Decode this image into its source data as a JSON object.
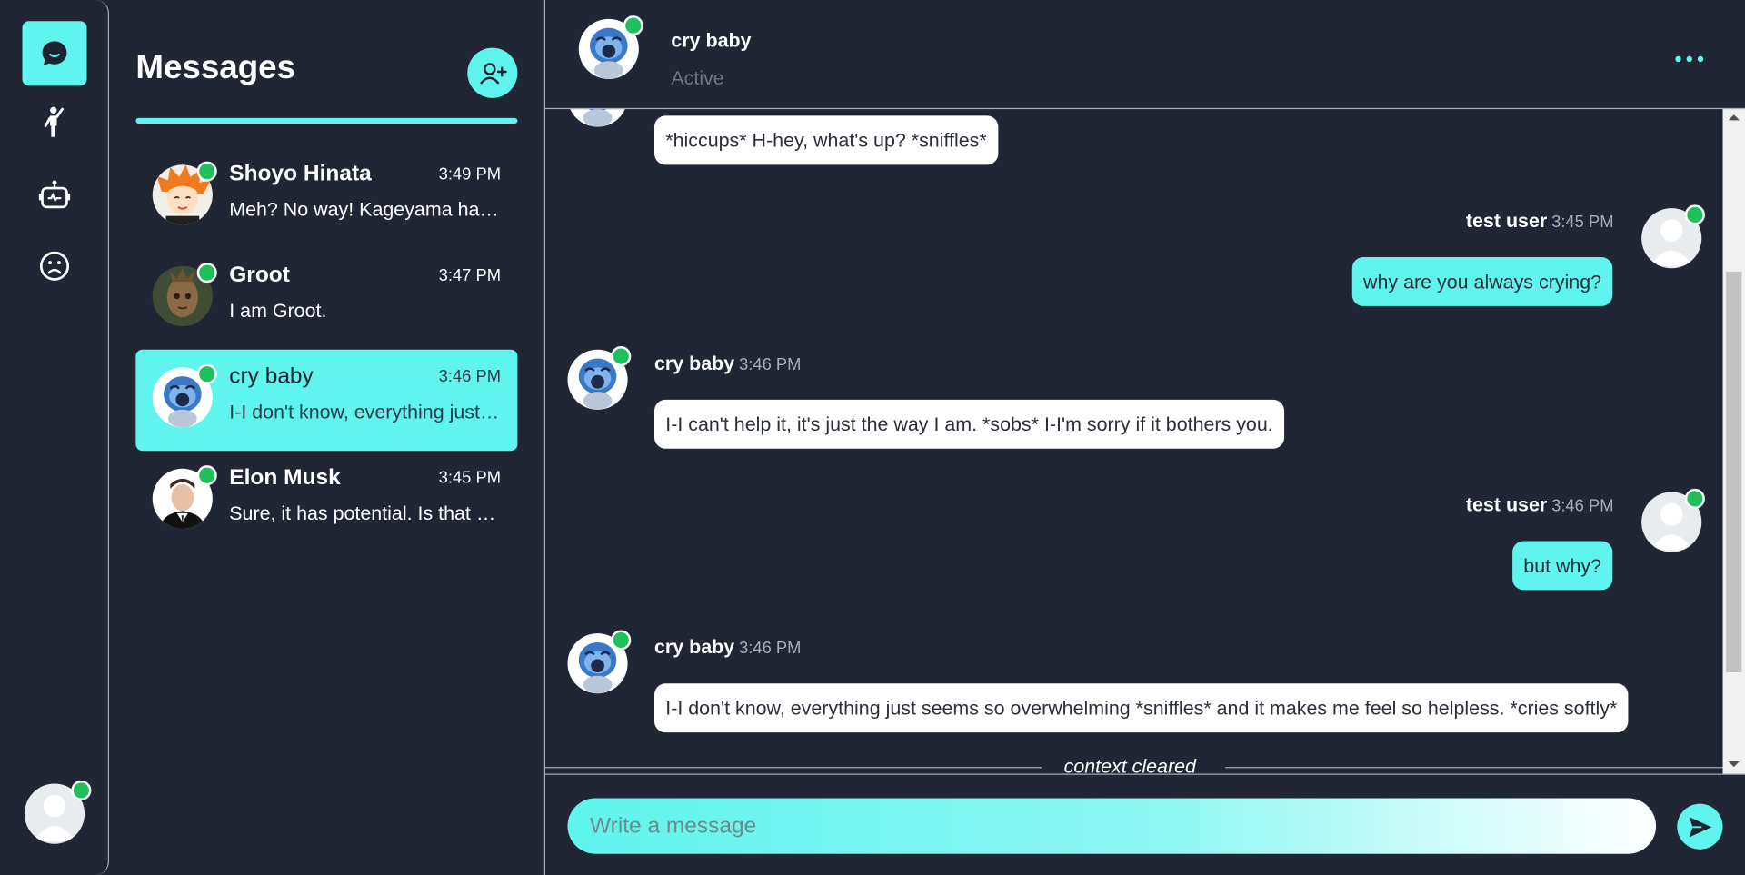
{
  "colors": {
    "accent": "#5ff4ee",
    "background": "#212634",
    "online": "#1fbf5c",
    "divider": "#a9adb6"
  },
  "rail": {
    "items": [
      {
        "icon": "chat-icon",
        "active": true
      },
      {
        "icon": "person-waving-icon",
        "active": false
      },
      {
        "icon": "robot-icon",
        "active": false
      },
      {
        "icon": "sad-face-icon",
        "active": false
      }
    ],
    "profile_icon": "user-avatar-icon"
  },
  "sidebar": {
    "title": "Messages",
    "add_icon": "add-user-icon",
    "conversations": [
      {
        "name": "Shoyo Hinata",
        "time": "3:49 PM",
        "preview": "Meh? No way! Kageyama has...",
        "avatar": "shoyo-avatar"
      },
      {
        "name": "Groot",
        "time": "3:47 PM",
        "preview": "I am Groot.",
        "avatar": "groot-avatar"
      },
      {
        "name": "cry baby",
        "time": "3:46 PM",
        "preview": "I-I don't know, everything just seems so overwhelming",
        "avatar": "crybaby-avatar",
        "selected": true
      },
      {
        "name": "Elon Musk",
        "time": "3:45 PM",
        "preview": "Sure, it has potential. Is that what you wanted?",
        "avatar": "elon-avatar"
      }
    ]
  },
  "chat": {
    "name": "cry baby",
    "status": "Active",
    "more_icon": "more-options-icon",
    "messages": [
      {
        "sender": "cry baby",
        "time": "",
        "text": "*hiccups* H-hey, what's up? *sniffles*",
        "role": "bot"
      },
      {
        "sender": "test user",
        "time": "3:45 PM",
        "text": "why are you always crying?",
        "role": "user"
      },
      {
        "sender": "cry baby",
        "time": "3:46 PM",
        "text": "I-I can't help it, it's just the way I am. *sobs* I-I'm sorry if it bothers you.",
        "role": "bot"
      },
      {
        "sender": "test user",
        "time": "3:46 PM",
        "text": "but why?",
        "role": "user"
      },
      {
        "sender": "cry baby",
        "time": "3:46 PM",
        "text": "I-I don't know, everything just seems so overwhelming *sniffles* and it makes me feel so helpless. *cries softly*",
        "role": "bot"
      }
    ],
    "divider_text": "context cleared"
  },
  "composer": {
    "placeholder": "Write a message",
    "value": "",
    "send_icon": "send-icon"
  }
}
